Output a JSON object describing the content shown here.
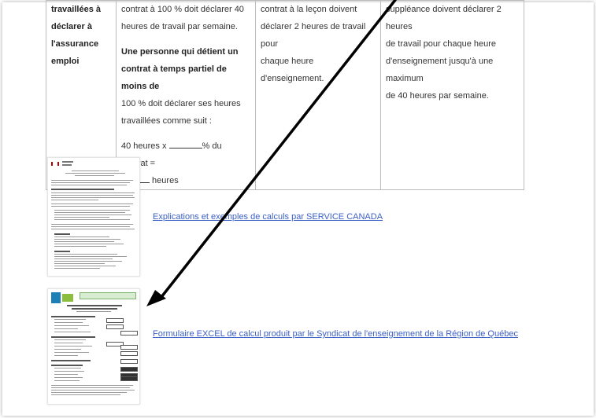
{
  "table": {
    "col1_lines": [
      "travaillées à",
      "déclarer à",
      "l'assurance",
      "emploi"
    ],
    "col2_lines": [
      "contrat à 100 % doit déclarer 40",
      "heures de travail par semaine."
    ],
    "col2_bold_lines": [
      "Une personne qui détient un",
      "contrat à temps partiel de moins de",
      "100 % doit déclarer ses heures"
    ],
    "col2_tail_lines": [
      "travaillées comme suit :"
    ],
    "col2_formula_start": "40 heures x ",
    "col2_formula_mid": "% du contrat =",
    "col2_formula_end": " heures",
    "col3_lines": [
      "contrat à la leçon doivent",
      "déclarer 2 heures de travail pour",
      "chaque heure d'enseignement."
    ],
    "col4_lines": [
      "suppléance doivent déclarer 2 heures",
      "de travail pour chaque heure",
      "d'enseignement jusqu'à une maximum",
      "de 40 heures par semaine."
    ]
  },
  "links": {
    "service_canada": "Explications et exemples de calculs par SERVICE CANADA",
    "excel_form": "Formulaire EXCEL de calcul produit par le Syndicat de l'enseignement de la Région de Québec"
  },
  "colors": {
    "link": "#3a5fc6",
    "arrow": "#000000"
  },
  "icons": {
    "thumb1": "document-thumbnail",
    "thumb2": "spreadsheet-thumbnail"
  }
}
